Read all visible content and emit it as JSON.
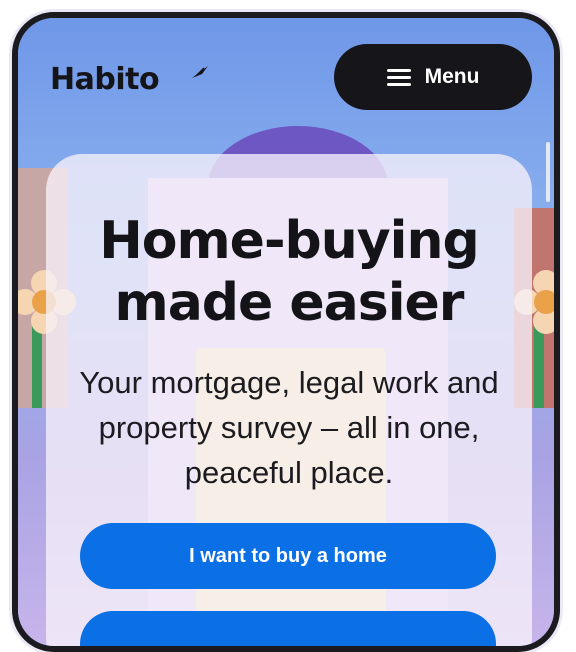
{
  "header": {
    "logo_text": "Habito",
    "menu_label": "Menu"
  },
  "hero": {
    "headline_line1": "Home-buying",
    "headline_line2": "made easier",
    "subtext": "Your mortgage, legal work and property survey – all in one, peaceful place.",
    "primary_cta": "I want to buy a home"
  },
  "icons": {
    "menu": "hamburger-icon",
    "logo_mark": "feather-mark"
  },
  "colors": {
    "primary_blue": "#0b6fe6",
    "dark": "#16151a",
    "card_bg": "#f7f1fa"
  }
}
